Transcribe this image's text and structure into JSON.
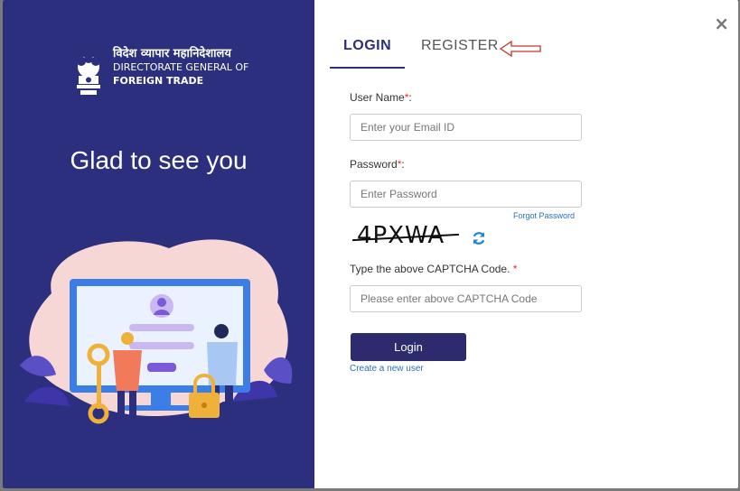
{
  "brand": {
    "hindi": "विदेश व्यापार महानिदेशालय",
    "line1": "DIRECTORATE GENERAL OF",
    "line2": "FOREIGN TRADE"
  },
  "welcome": "Glad to see you",
  "close_label": "×",
  "tabs": {
    "login": "LOGIN",
    "register": "REGISTER"
  },
  "form": {
    "username_label": "User Name",
    "username_placeholder": "Enter your Email ID",
    "password_label": "Password",
    "password_placeholder": "Enter Password",
    "forgot": "Forgot Password",
    "captcha_text": "4PXWA",
    "captcha_label": "Type the above CAPTCHA Code.",
    "captcha_placeholder": "Please enter above CAPTCHA Code",
    "required_mark": "*",
    "colon": ":",
    "login_button": "Login",
    "create_user": "Create a new user"
  },
  "icons": {
    "close": "close-icon",
    "refresh": "refresh-icon",
    "arrow": "arrow-left-icon"
  },
  "colors": {
    "panel": "#2b2f7e",
    "button": "#2b2b6e",
    "link": "#2a6fc1",
    "required": "#d33333"
  }
}
